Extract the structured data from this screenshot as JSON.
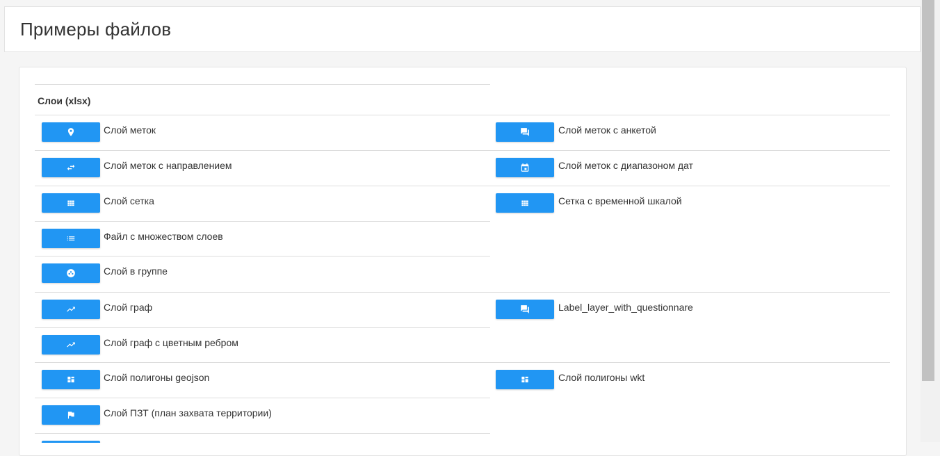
{
  "page": {
    "title": "Примеры файлов"
  },
  "group": {
    "title": "Слои (xlsx)"
  },
  "rows": [
    {
      "left": {
        "icon": "map-marker-icon",
        "label": "Слой меток"
      },
      "right": {
        "icon": "forum-icon",
        "label": "Слой меток с анкетой"
      }
    },
    {
      "left": {
        "icon": "swap-arrows-icon",
        "label": "Слой меток с направлением"
      },
      "right": {
        "icon": "calendar-icon",
        "label": "Слой меток с диапазоном дат"
      }
    },
    {
      "left": {
        "icon": "grid-icon",
        "label": "Слой сетка"
      },
      "right": {
        "icon": "grid-icon",
        "label": "Сетка с временной шкалой"
      }
    },
    {
      "left": {
        "icon": "list-icon",
        "label": "Файл с множеством слоев"
      }
    },
    {
      "left": {
        "icon": "group-icon",
        "label": "Слой в группе"
      }
    },
    {
      "left": {
        "icon": "trending-up-icon",
        "label": "Слой граф"
      },
      "right": {
        "icon": "forum-icon",
        "label": "Label_layer_with_questionnare"
      }
    },
    {
      "left": {
        "icon": "trending-up-icon",
        "label": "Слой граф с цветным ребром"
      }
    },
    {
      "left": {
        "icon": "dashboard-icon",
        "label": "Слой полигоны geojson"
      },
      "right": {
        "icon": "dashboard-icon",
        "label": "Слой полигоны wkt"
      }
    },
    {
      "left": {
        "icon": "flag-icon",
        "label": "Слой ПЗТ (план захвата территории)"
      }
    }
  ],
  "colors": {
    "button": "#2196f3",
    "border": "#dddddd",
    "text": "#333333"
  }
}
